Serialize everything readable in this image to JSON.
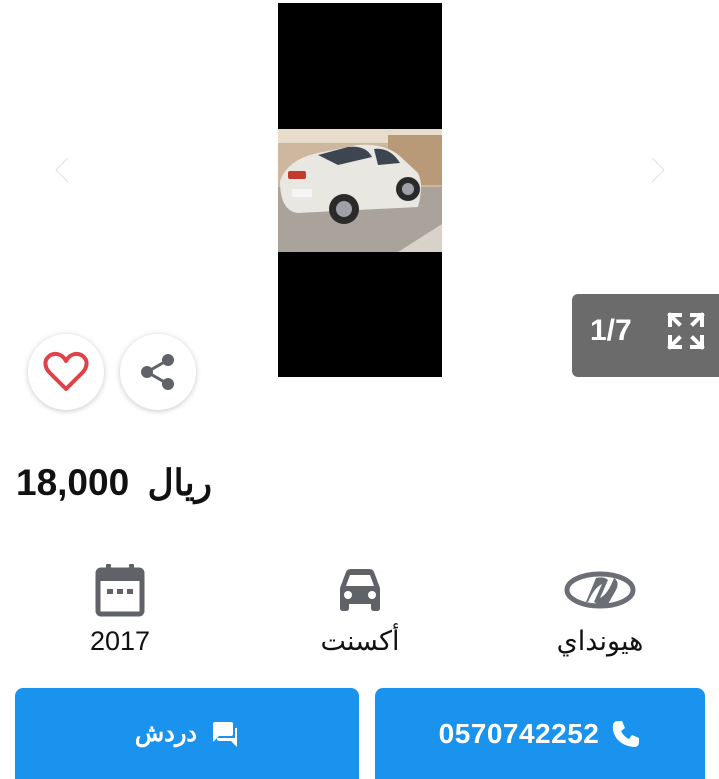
{
  "gallery": {
    "counter": "1/7",
    "icons": {
      "prev": "chevron-left-icon",
      "next": "chevron-right-icon",
      "fullscreen": "fullscreen-icon"
    }
  },
  "actions_top": {
    "favorite_icon": "heart-icon",
    "share_icon": "share-icon"
  },
  "listing": {
    "price": "18,000",
    "currency": "ريال"
  },
  "specs": [
    {
      "icon": "calendar-icon",
      "label": "2017"
    },
    {
      "icon": "car-icon",
      "label": "أكسنت"
    },
    {
      "icon": "hyundai-logo",
      "label": "هيونداي"
    }
  ],
  "buttons": {
    "chat_label": "دردش",
    "call_label": "0570742252"
  },
  "colors": {
    "accent": "#1a93ee",
    "counter_bg": "#6b6b6b",
    "heart": "#e0424b",
    "icon_gray": "#5f6368"
  }
}
